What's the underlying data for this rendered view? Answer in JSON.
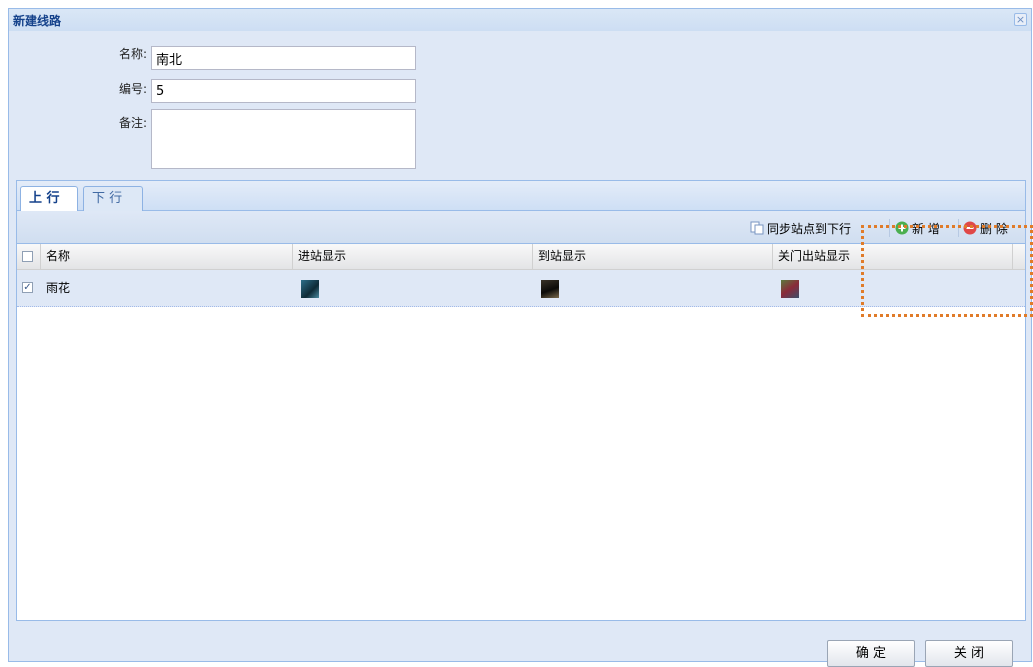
{
  "window": {
    "title": "新建线路",
    "close_glyph": "×"
  },
  "form": {
    "name_label": "名称:",
    "name_value": "南北",
    "code_label": "编号:",
    "code_value": "5",
    "remark_label": "备注:",
    "remark_value": ""
  },
  "tabs": [
    {
      "label": "上 行",
      "active": true
    },
    {
      "label": "下 行",
      "active": false
    }
  ],
  "toolbar": {
    "sync_label": "同步站点到下行",
    "sync_icon": "copy-icon",
    "add_label": "新 增",
    "add_icon": "plus-circle-icon",
    "delete_label": "删 除",
    "delete_icon": "minus-circle-icon"
  },
  "grid": {
    "columns": [
      "名称",
      "进站显示",
      "到站显示",
      "关门出站显示"
    ],
    "rows": [
      {
        "checked": true,
        "name": "雨花",
        "enter_display": "image-thumbnail",
        "arrive_display": "image-thumbnail",
        "close_display": "image-thumbnail"
      }
    ]
  },
  "footer": {
    "confirm_label": "确 定",
    "close_label": "关 闭"
  },
  "colors": {
    "accent": "#15428b",
    "panel_bg": "#dfe8f6",
    "border": "#99bbe8",
    "highlight": "#e07b29",
    "add_icon": "#4caf50",
    "delete_icon": "#e04848"
  }
}
